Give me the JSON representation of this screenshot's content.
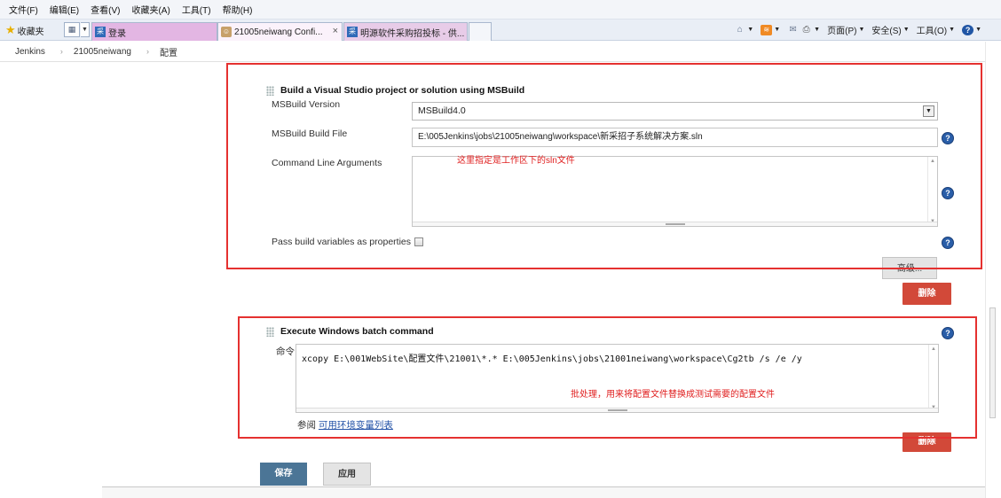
{
  "menu": [
    "文件(F)",
    "编辑(E)",
    "查看(V)",
    "收藏夹(A)",
    "工具(T)",
    "帮助(H)"
  ],
  "favorites_label": "收藏夹",
  "tabs": [
    {
      "icon": "采",
      "title": "登录"
    },
    {
      "icon": "",
      "title": "21005neiwang Confi..."
    },
    {
      "icon": "采",
      "title": "明源软件采购招投标 - 供..."
    }
  ],
  "toolbar": {
    "page": "页面(P)",
    "safety": "安全(S)",
    "tools": "工具(O)",
    "help_glyph": "?"
  },
  "breadcrumb": [
    "Jenkins",
    "21005neiwang",
    "配置"
  ],
  "msbuild": {
    "title": "Build a Visual Studio project or solution using MSBuild",
    "version_label": "MSBuild Version",
    "version_value": "MSBuild4.0",
    "file_label": "MSBuild Build File",
    "file_value": "E:\\005Jenkins\\jobs\\21005neiwang\\workspace\\新采招子系统解决方案.sln",
    "args_label": "Command Line Arguments",
    "annotation": "这里指定是工作区下的sln文件",
    "pass_vars_label": "Pass build variables as properties",
    "advanced_button": "高级...",
    "delete_button": "删除"
  },
  "batch": {
    "title": "Execute Windows batch command",
    "command_label": "命令",
    "command_value": "xcopy E:\\001WebSite\\配置文件\\21001\\*.* E:\\005Jenkins\\jobs\\21001neiwang\\workspace\\Cg2tb /s /e /y",
    "annotation": "批处理，用来将配置文件替换成测试需要的配置文件",
    "see_prefix": "参阅",
    "env_link": "可用环境变量列表",
    "delete_button": "删除"
  },
  "footer": {
    "save": "保存",
    "apply": "应用"
  },
  "colors": {
    "annotation_red": "#e53130",
    "delete_red": "#d24939",
    "save_blue": "#4b7596"
  }
}
